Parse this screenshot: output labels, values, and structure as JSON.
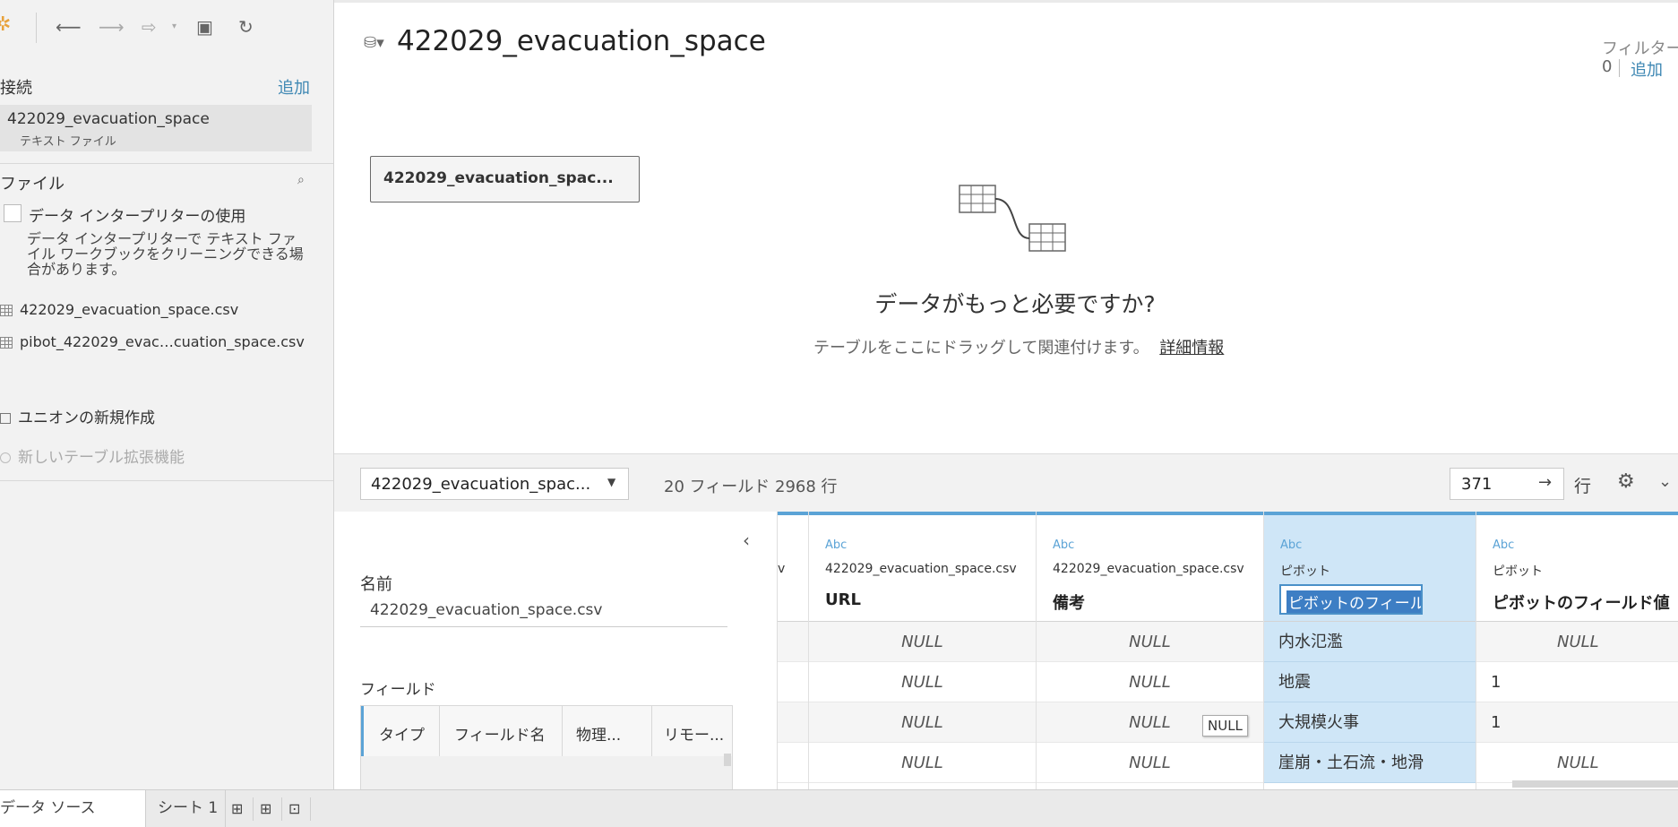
{
  "left_panel": {
    "connections_title": "接続",
    "connections_add": "追加",
    "connection_name": "422029_evacuation_space",
    "connection_type": "テキスト ファイル",
    "files_title": "ファイル",
    "interpreter_label": "データ インタープリターの使用",
    "interpreter_desc": "データ インタープリターで テキスト ファイル ワークブックをクリーニングできる場合があります。",
    "files": [
      "422029_evacuation_space.csv",
      "pibot_422029_evac…cuation_space.csv"
    ],
    "new_union": "ユニオンの新規作成",
    "new_extension": "新しいテーブル拡張機能"
  },
  "header": {
    "datasource_title": "422029_evacuation_space",
    "filters_label": "フィルター",
    "filters_count": "0",
    "filters_add": "追加"
  },
  "canvas": {
    "table_name": "422029_evacuation_spac...",
    "need_more": "データがもっと必要ですか?",
    "drag_hint": "テーブルをここにドラッグして関連付けます。",
    "learn_more": "詳細情報"
  },
  "toolbar": {
    "table_select": "422029_evacuation_spac...",
    "field_info": "20 フィールド 2968 行",
    "rows_value": "371",
    "rows_label": "行"
  },
  "metadata": {
    "name_label": "名前",
    "name_value": "422029_evacuation_space.csv",
    "fields_label": "フィールド",
    "columns": [
      "タイプ",
      "フィールド名",
      "物理...",
      "リモー..."
    ]
  },
  "grid": {
    "partial_col_src": "v",
    "columns": [
      {
        "type": "Abc",
        "source": "422029_evacuation_space.csv",
        "name": "URL"
      },
      {
        "type": "Abc",
        "source": "422029_evacuation_space.csv",
        "name": "備考"
      },
      {
        "type": "Abc",
        "source": "ピボット",
        "name": "ピボットのフィールド名"
      },
      {
        "type": "Abc",
        "source": "ピボット",
        "name": "ピボットのフィールド値"
      }
    ],
    "rows": [
      [
        "NULL",
        "NULL",
        "内水氾濫",
        "NULL"
      ],
      [
        "NULL",
        "NULL",
        "地震",
        "1"
      ],
      [
        "NULL",
        "NULL",
        "大規模火事",
        "1"
      ],
      [
        "NULL",
        "NULL",
        "崖崩・土石流・地滑",
        "NULL"
      ]
    ],
    "tooltip": "NULL"
  },
  "tabs": {
    "datasource": "データ ソース",
    "sheet1": "シート 1"
  },
  "colors": {
    "accent": "#3d87b3",
    "selected_col": "#cfe6f7",
    "header_bar": "#5ba3d6"
  }
}
